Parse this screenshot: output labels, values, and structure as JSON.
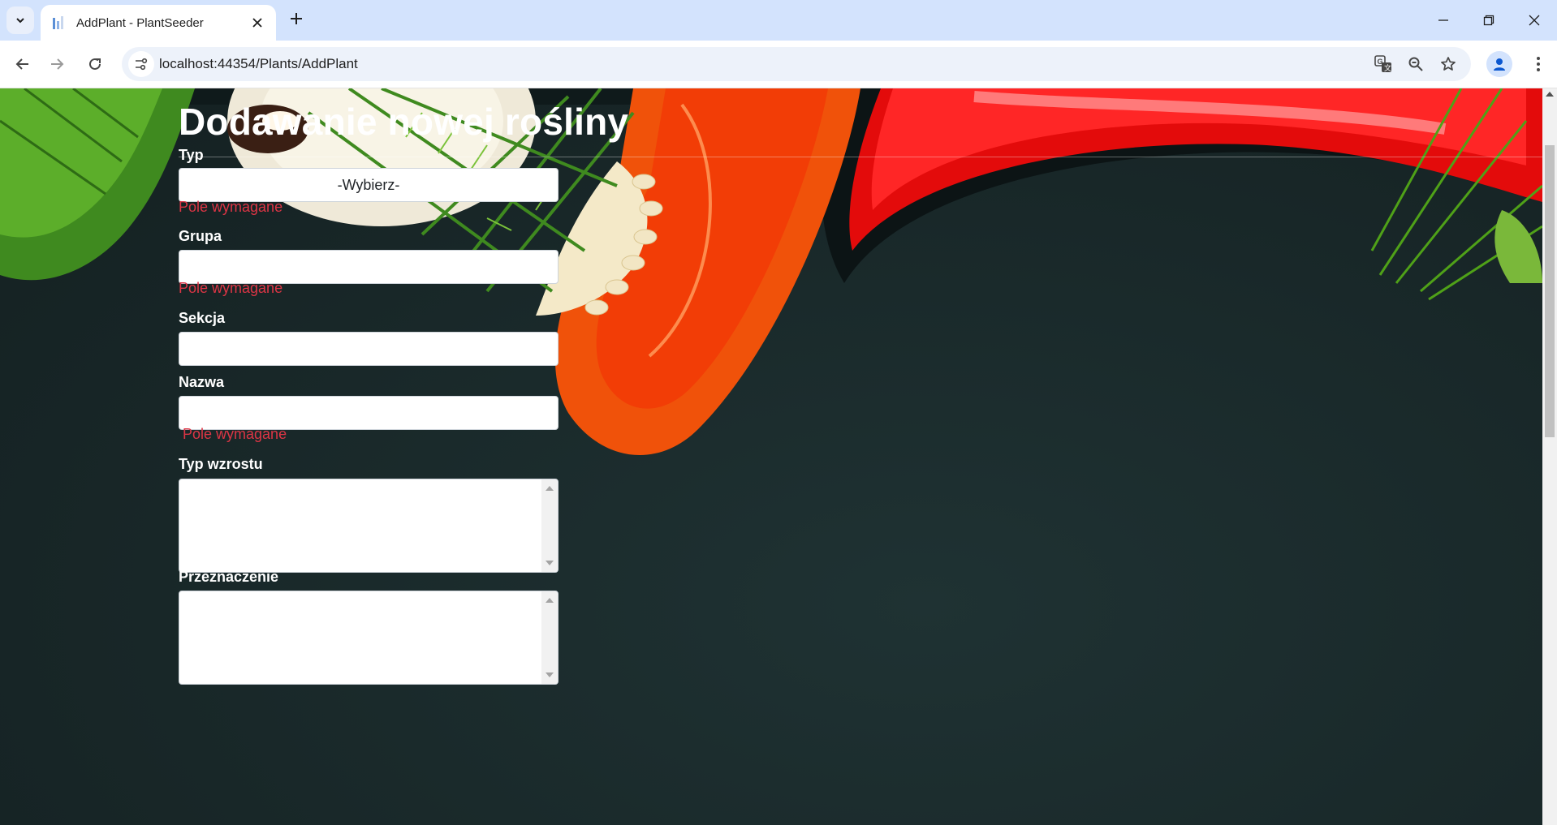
{
  "browser": {
    "tab_title": "AddPlant - PlantSeeder",
    "url": "localhost:44354/Plants/AddPlant"
  },
  "page": {
    "title": "Dodawanie nowej rośliny"
  },
  "form": {
    "fields": [
      {
        "label": "Typ",
        "type": "select",
        "value": "-Wybierz-",
        "error": "Pole wymagane"
      },
      {
        "label": "Grupa",
        "type": "text",
        "value": "",
        "error": "Pole wymagane"
      },
      {
        "label": "Sekcja",
        "type": "text",
        "value": "",
        "error": ""
      },
      {
        "label": "Nazwa",
        "type": "text",
        "value": "",
        "error": "Pole wymagane"
      },
      {
        "label": "Typ wzrostu",
        "type": "textarea",
        "value": "",
        "error": ""
      },
      {
        "label": "Przeznaczenie",
        "type": "textarea",
        "value": "",
        "error": ""
      }
    ]
  },
  "colors": {
    "error": "#dc3545",
    "background": "#1b2a2b",
    "tabbar": "#d3e3fd"
  },
  "icons": [
    "tab-search-icon",
    "close-icon",
    "plus-icon",
    "minimize-icon",
    "restore-icon",
    "back-icon",
    "forward-icon",
    "reload-icon",
    "site-info-icon",
    "translate-icon",
    "zoom-icon",
    "star-icon",
    "profile-icon",
    "kebab-menu-icon"
  ]
}
